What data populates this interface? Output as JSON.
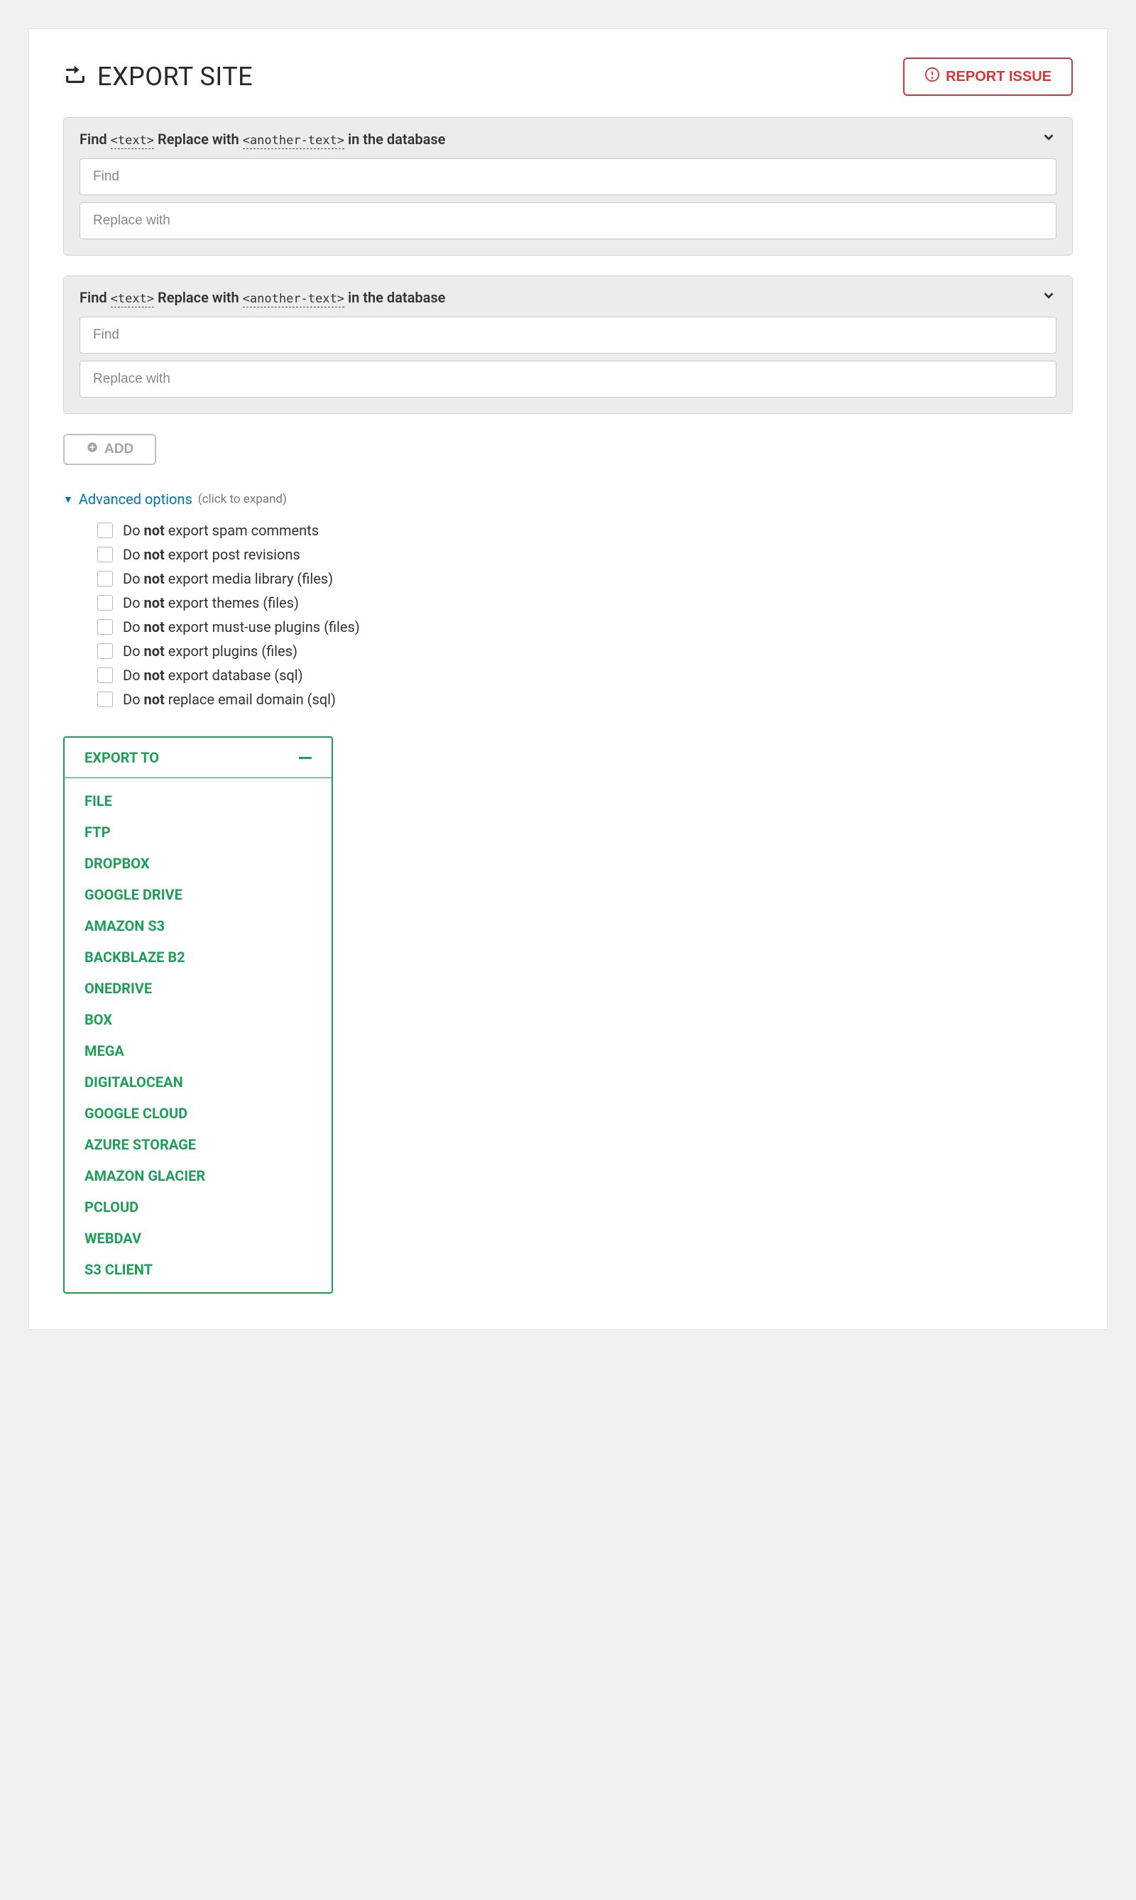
{
  "header": {
    "title": "EXPORT SITE",
    "report_label": "REPORT ISSUE"
  },
  "find_replace": {
    "header_find": "Find",
    "header_token1": "<text>",
    "header_mid": "Replace with",
    "header_token2": "<another-text>",
    "header_suffix": "in the database",
    "find_placeholder": "Find",
    "replace_placeholder": "Replace with"
  },
  "add_label": "ADD",
  "advanced": {
    "label": "Advanced options",
    "hint": "(click to expand)",
    "options": [
      {
        "pre": "Do ",
        "bold": "not",
        "post": " export spam comments"
      },
      {
        "pre": "Do ",
        "bold": "not",
        "post": " export post revisions"
      },
      {
        "pre": "Do ",
        "bold": "not",
        "post": " export media library (files)"
      },
      {
        "pre": "Do ",
        "bold": "not",
        "post": " export themes (files)"
      },
      {
        "pre": "Do ",
        "bold": "not",
        "post": " export must-use plugins (files)"
      },
      {
        "pre": "Do ",
        "bold": "not",
        "post": " export plugins (files)"
      },
      {
        "pre": "Do ",
        "bold": "not",
        "post": " export database (sql)"
      },
      {
        "pre": "Do ",
        "bold": "not",
        "post": " replace email domain (sql)"
      }
    ]
  },
  "export": {
    "header": "EXPORT TO",
    "destinations": [
      "FILE",
      "FTP",
      "DROPBOX",
      "GOOGLE DRIVE",
      "AMAZON S3",
      "BACKBLAZE B2",
      "ONEDRIVE",
      "BOX",
      "MEGA",
      "DIGITALOCEAN",
      "GOOGLE CLOUD",
      "AZURE STORAGE",
      "AMAZON GLACIER",
      "PCLOUD",
      "WEBDAV",
      "S3 CLIENT"
    ]
  }
}
